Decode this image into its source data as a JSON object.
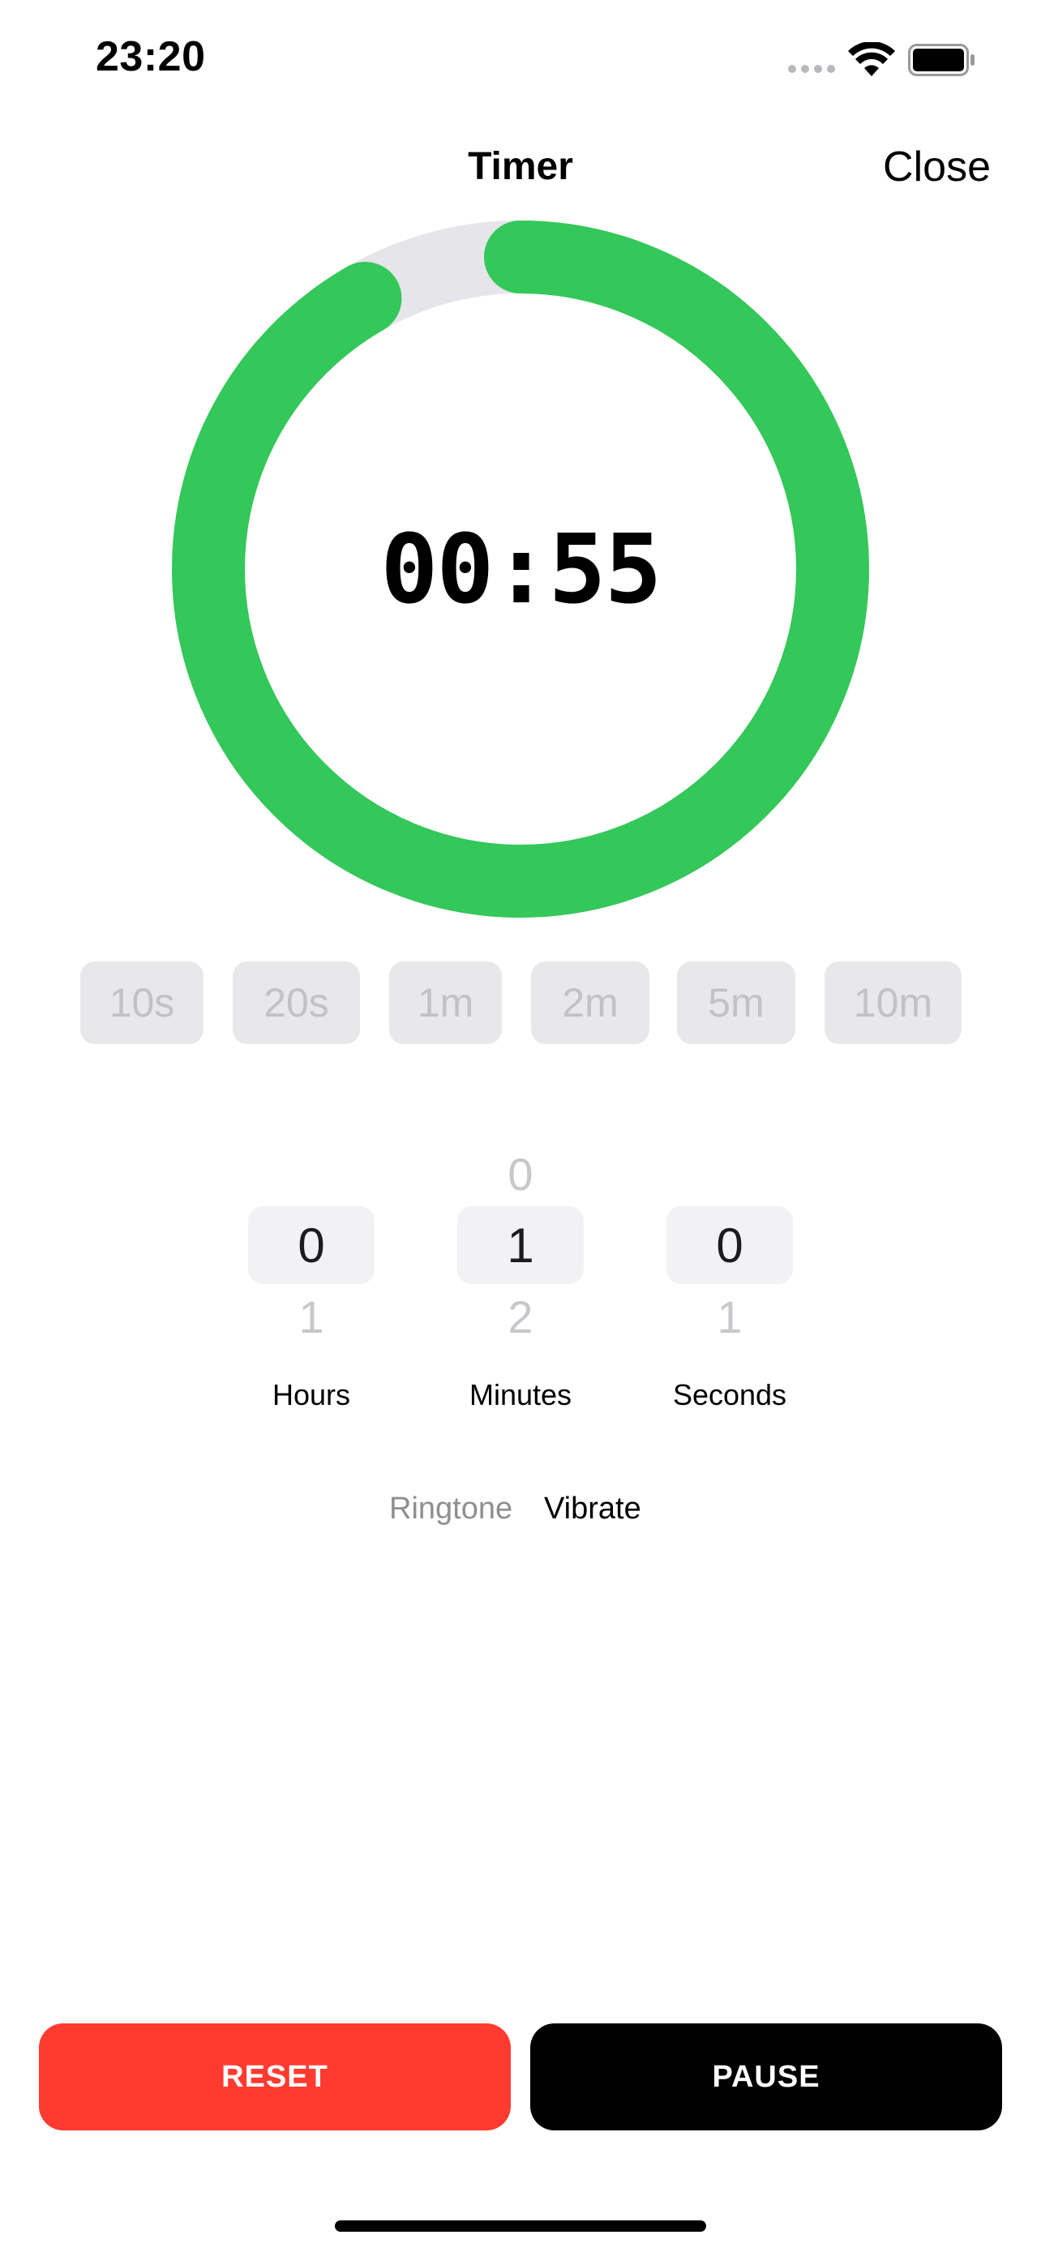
{
  "status_bar": {
    "time": "23:20",
    "icons": [
      "cellular-signal-icon",
      "wifi-icon",
      "battery-icon"
    ]
  },
  "nav": {
    "title": "Timer",
    "close_label": "Close"
  },
  "timer": {
    "display": "00:55",
    "progress_fraction": 0.917,
    "progress_color": "#34c759",
    "track_color": "#e5e5ea"
  },
  "presets": [
    "10s",
    "20s",
    "1m",
    "2m",
    "5m",
    "10m"
  ],
  "pickers": {
    "hours": {
      "above": "",
      "value": "0",
      "below": "1",
      "label": "Hours"
    },
    "minutes": {
      "above": "0",
      "value": "1",
      "below": "2",
      "label": "Minutes"
    },
    "seconds": {
      "above": "",
      "value": "0",
      "below": "1",
      "label": "Seconds"
    }
  },
  "alert_mode": {
    "options": [
      "Ringtone",
      "Vibrate"
    ],
    "selected": "Vibrate"
  },
  "buttons": {
    "reset_label": "RESET",
    "pause_label": "PAUSE"
  },
  "colors": {
    "reset": "#ff3b30",
    "pause": "#000000",
    "preset_bg": "#e8e8ea",
    "preset_text": "#c2c2c6"
  }
}
